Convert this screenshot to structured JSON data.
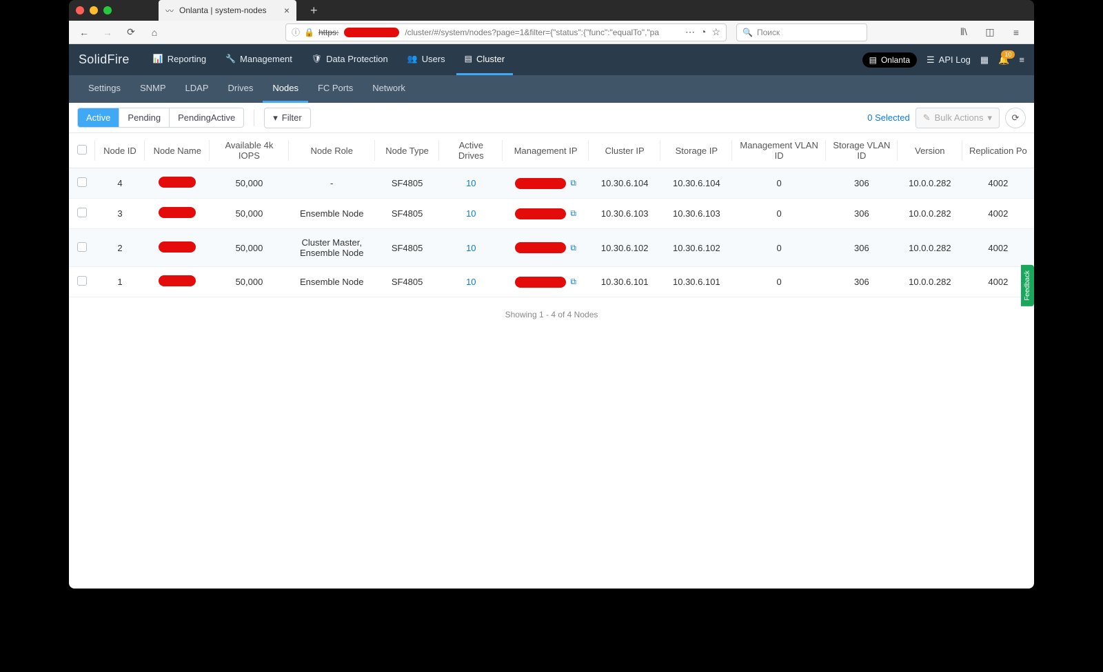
{
  "browser": {
    "tab_title": "Onlanta | system-nodes",
    "url_protocol": "https:",
    "url_rest": "/cluster/#/system/nodes?page=1&filter={\"status\":{\"func\":\"equalTo\",\"pa",
    "search_placeholder": "Поиск"
  },
  "app": {
    "brand": "SolidFire",
    "cluster_name": "Onlanta",
    "api_log_label": "API Log",
    "notification_count": "10",
    "feedback_label": "Feedback",
    "top_menu": [
      {
        "label": "Reporting",
        "icon": "📊",
        "active": false
      },
      {
        "label": "Management",
        "icon": "🔧",
        "active": false
      },
      {
        "label": "Data Protection",
        "icon": "🛡",
        "active": false
      },
      {
        "label": "Users",
        "icon": "👥",
        "active": false
      },
      {
        "label": "Cluster",
        "icon": "▤",
        "active": true
      }
    ],
    "sub_nav": [
      {
        "label": "Settings",
        "active": false
      },
      {
        "label": "SNMP",
        "active": false
      },
      {
        "label": "LDAP",
        "active": false
      },
      {
        "label": "Drives",
        "active": false
      },
      {
        "label": "Nodes",
        "active": true
      },
      {
        "label": "FC Ports",
        "active": false
      },
      {
        "label": "Network",
        "active": false
      }
    ]
  },
  "toolbar": {
    "tabs": [
      {
        "label": "Active",
        "active": true
      },
      {
        "label": "Pending",
        "active": false
      },
      {
        "label": "PendingActive",
        "active": false
      }
    ],
    "filter_label": "Filter",
    "selected_text": "0 Selected",
    "bulk_actions_label": "Bulk Actions"
  },
  "table": {
    "columns": [
      "",
      "Node ID",
      "Node Name",
      "Available 4k IOPS",
      "Node Role",
      "Node Type",
      "Active Drives",
      "Management IP",
      "Cluster IP",
      "Storage IP",
      "Management VLAN ID",
      "Storage VLAN ID",
      "Version",
      "Replication Po"
    ],
    "rows": [
      {
        "node_id": "4",
        "iops": "50,000",
        "role": "-",
        "type": "SF4805",
        "drives": "10",
        "cluster_ip": "10.30.6.104",
        "storage_ip": "10.30.6.104",
        "mvlan": "0",
        "svlan": "306",
        "version": "10.0.0.282",
        "rep": "4002"
      },
      {
        "node_id": "3",
        "iops": "50,000",
        "role": "Ensemble Node",
        "type": "SF4805",
        "drives": "10",
        "cluster_ip": "10.30.6.103",
        "storage_ip": "10.30.6.103",
        "mvlan": "0",
        "svlan": "306",
        "version": "10.0.0.282",
        "rep": "4002"
      },
      {
        "node_id": "2",
        "iops": "50,000",
        "role": "Cluster Master, Ensemble Node",
        "type": "SF4805",
        "drives": "10",
        "cluster_ip": "10.30.6.102",
        "storage_ip": "10.30.6.102",
        "mvlan": "0",
        "svlan": "306",
        "version": "10.0.0.282",
        "rep": "4002"
      },
      {
        "node_id": "1",
        "iops": "50,000",
        "role": "Ensemble Node",
        "type": "SF4805",
        "drives": "10",
        "cluster_ip": "10.30.6.101",
        "storage_ip": "10.30.6.101",
        "mvlan": "0",
        "svlan": "306",
        "version": "10.0.0.282",
        "rep": "4002"
      }
    ],
    "footer": "Showing 1 - 4 of 4 Nodes"
  }
}
